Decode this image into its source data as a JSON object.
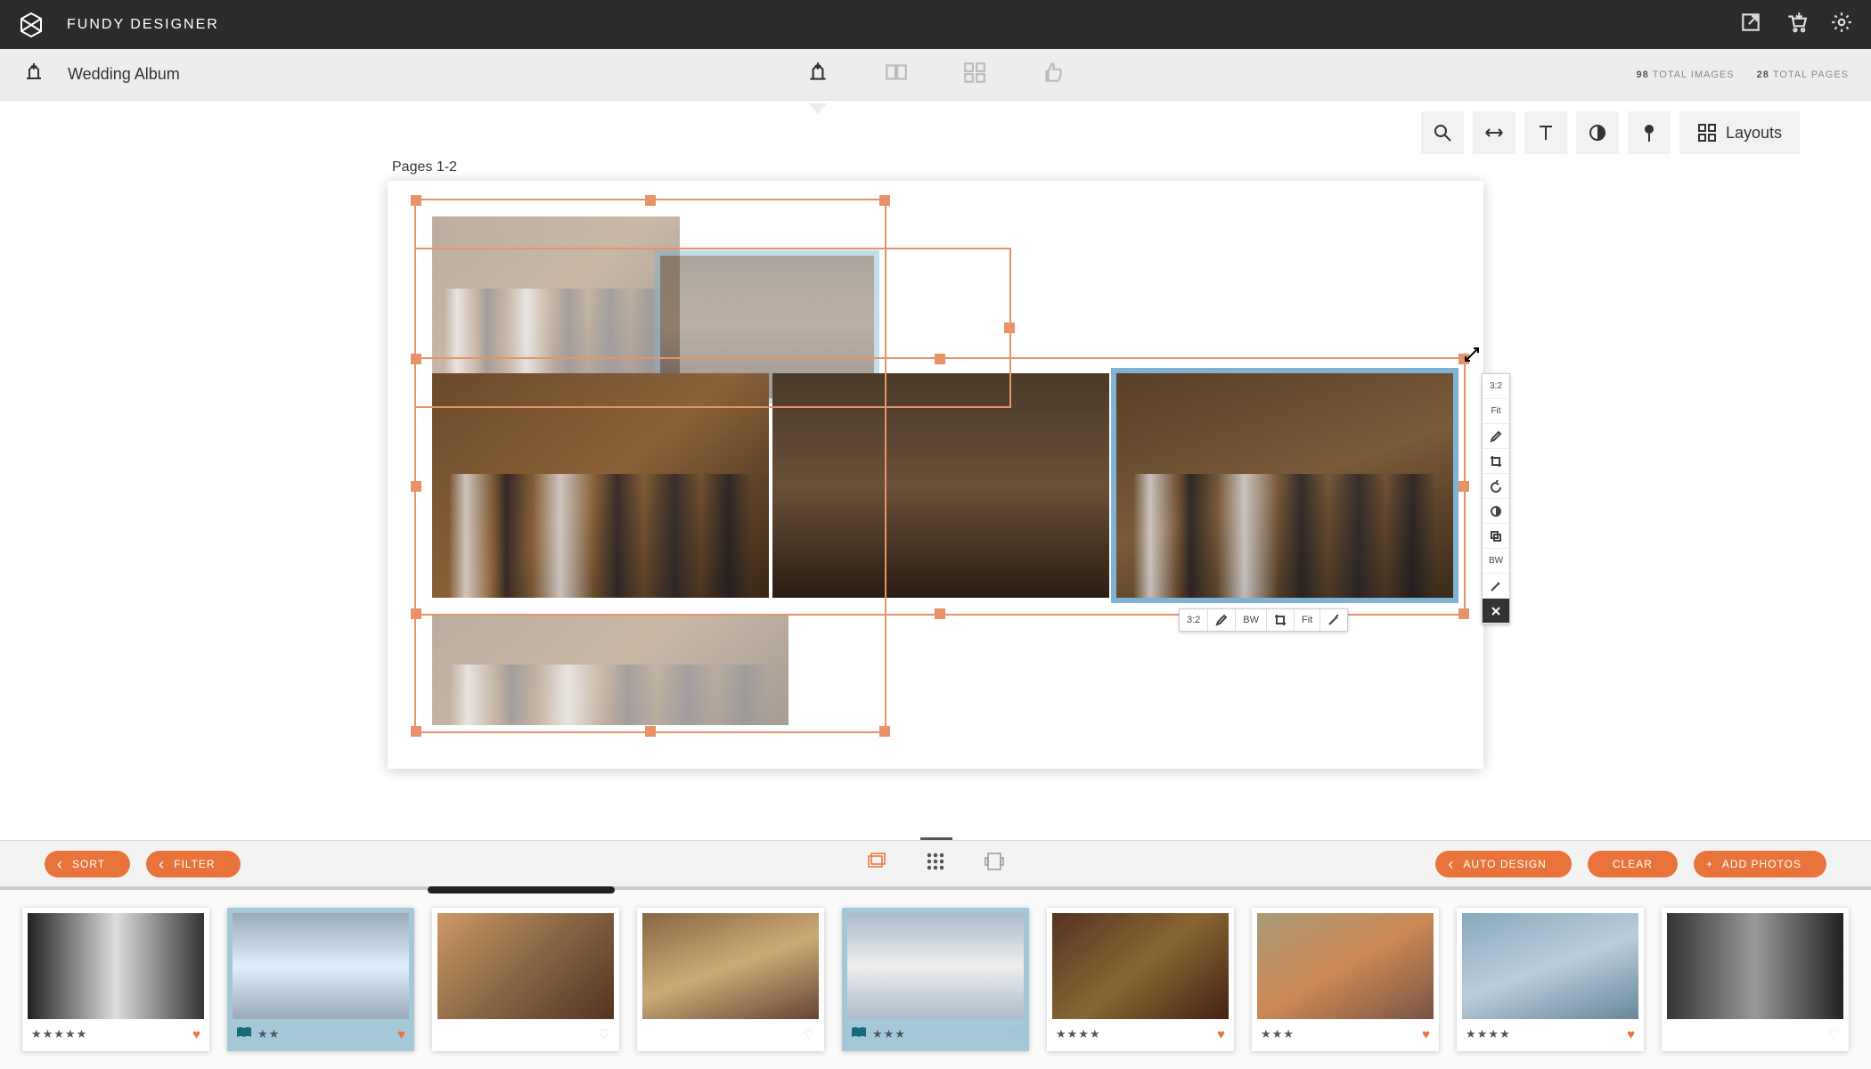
{
  "app_title": "FUNDY DESIGNER",
  "project_name": "Wedding Album",
  "stats": {
    "images_count": "98",
    "images_label": "TOTAL IMAGES",
    "pages_count": "28",
    "pages_label": "TOTAL PAGES"
  },
  "layouts_label": "Layouts",
  "pages_label": "Pages 1-2",
  "horiz_bar": {
    "ratio": "3:2",
    "bw": "BW",
    "fit": "Fit"
  },
  "side_bar": {
    "ratio": "3:2",
    "fit": "Fit",
    "bw": "BW"
  },
  "lib_buttons": {
    "sort": "SORT",
    "filter": "FILTER",
    "auto_design": "AUTO DESIGN",
    "clear": "CLEAR",
    "add_photos": "ADD PHOTOS"
  },
  "thumbs": [
    {
      "stars": 5,
      "fav": true,
      "used": false,
      "selected": false,
      "img": "a"
    },
    {
      "stars": 2,
      "fav": true,
      "used": true,
      "selected": true,
      "img": "b"
    },
    {
      "stars": 0,
      "fav": false,
      "used": false,
      "selected": false,
      "img": "c"
    },
    {
      "stars": 0,
      "fav": false,
      "used": false,
      "selected": false,
      "img": "d"
    },
    {
      "stars": 3,
      "fav": false,
      "used": true,
      "selected": true,
      "img": "e"
    },
    {
      "stars": 4,
      "fav": true,
      "used": false,
      "selected": false,
      "img": "f"
    },
    {
      "stars": 3,
      "fav": true,
      "used": false,
      "selected": false,
      "img": "g"
    },
    {
      "stars": 4,
      "fav": true,
      "used": false,
      "selected": false,
      "img": "h"
    },
    {
      "stars": 0,
      "fav": false,
      "used": false,
      "selected": false,
      "img": "i"
    }
  ]
}
